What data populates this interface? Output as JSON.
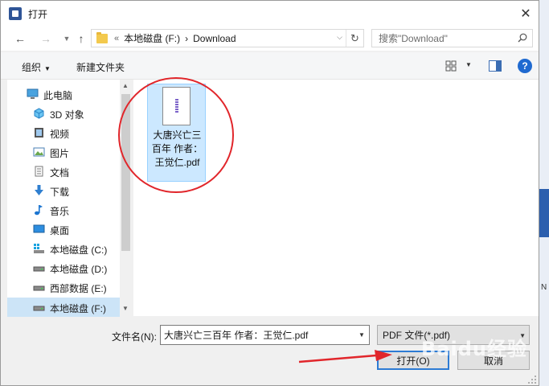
{
  "window": {
    "title": "打开",
    "close_glyph": "✕"
  },
  "address": {
    "back_glyph": "←",
    "forward_glyph": "→",
    "up_glyph": "↑",
    "crumb_sep": "«",
    "crumbs": [
      "本地磁盘 (F:)",
      "Download"
    ],
    "crumb_arrow": "›",
    "refresh_glyph": "↻"
  },
  "search": {
    "placeholder": "搜索\"Download\""
  },
  "toolbar": {
    "organize_label": "组织",
    "new_folder_label": "新建文件夹",
    "help_label": "?"
  },
  "sidebar": {
    "items": [
      {
        "label": "此电脑",
        "icon": "computer-icon"
      },
      {
        "label": "3D 对象",
        "icon": "cube-3d-icon"
      },
      {
        "label": "视频",
        "icon": "video-icon"
      },
      {
        "label": "图片",
        "icon": "picture-icon"
      },
      {
        "label": "文档",
        "icon": "document-icon"
      },
      {
        "label": "下载",
        "icon": "download-icon"
      },
      {
        "label": "音乐",
        "icon": "music-icon"
      },
      {
        "label": "桌面",
        "icon": "desktop-icon"
      },
      {
        "label": "本地磁盘 (C:)",
        "icon": "drive-c-icon"
      },
      {
        "label": "本地磁盘 (D:)",
        "icon": "drive-icon"
      },
      {
        "label": "西部数据 (E:)",
        "icon": "drive-icon"
      },
      {
        "label": "本地磁盘 (F:)",
        "icon": "drive-icon"
      }
    ],
    "selected_index": 11
  },
  "files": [
    {
      "name": "大唐兴亡三百年 作者：王觉仁.pdf",
      "selected": true
    }
  ],
  "footer": {
    "filename_label": "文件名(N):",
    "filename_value": "大唐兴亡三百年 作者：王觉仁.pdf",
    "filetype_value": "PDF 文件(*.pdf)",
    "open_label": "打开(O)",
    "cancel_label": "取消"
  },
  "background": {
    "right_edge_text": "N"
  },
  "watermark": "Baidu经验",
  "colors": {
    "accent": "#2d7bd4",
    "selection": "#cce8ff",
    "annotation": "#e1262b"
  }
}
